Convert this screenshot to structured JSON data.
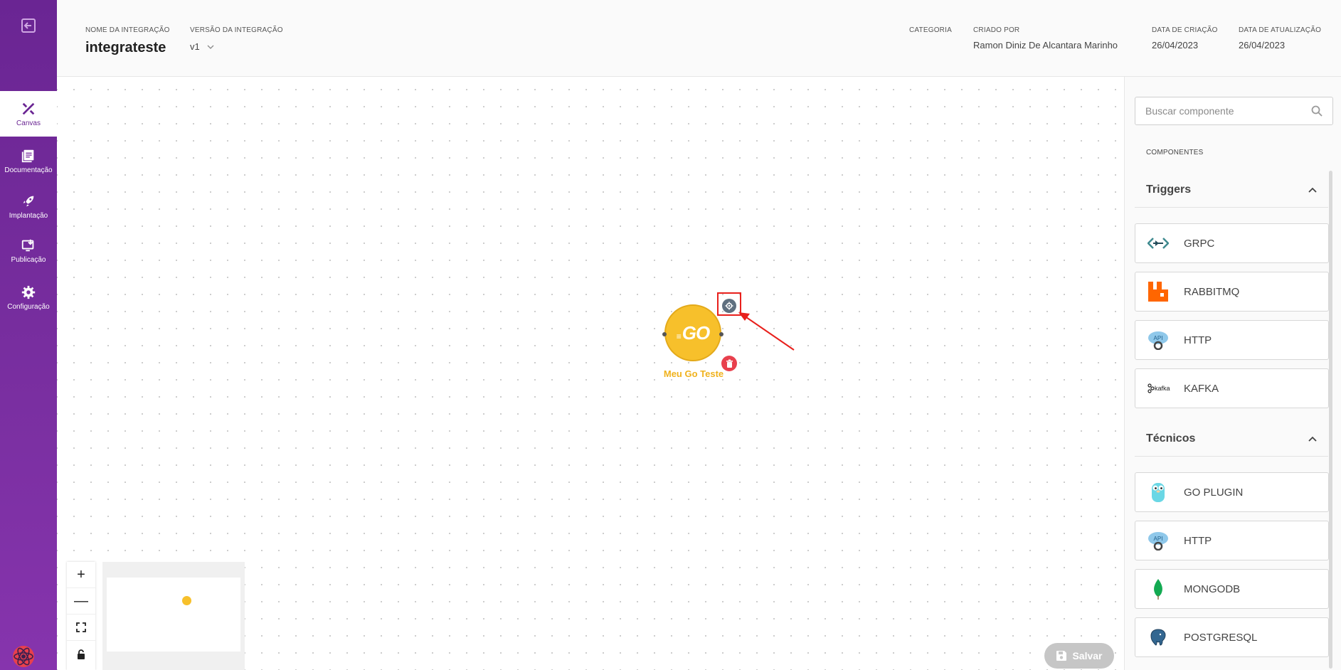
{
  "sidebar": {
    "exit_icon": "exit-icon",
    "items": [
      {
        "label": "Canvas",
        "icon": "tools-icon",
        "active": true
      },
      {
        "label": "Documentação",
        "icon": "book-icon",
        "active": false
      },
      {
        "label": "Implantação",
        "icon": "rocket-icon",
        "active": false
      },
      {
        "label": "Publicação",
        "icon": "publish-icon",
        "active": false
      },
      {
        "label": "Configuração",
        "icon": "gear-icon",
        "active": false
      }
    ]
  },
  "header": {
    "name_label": "NOME DA INTEGRAÇÃO",
    "name_value": "integrateste",
    "version_label": "VERSÃO DA INTEGRAÇÃO",
    "version_value": "v1",
    "category_label": "CATEGORIA",
    "category_value": "",
    "created_by_label": "CRIADO POR",
    "created_by_value": "Ramon Diniz De Alcantara Marinho",
    "created_date_label": "DATA DE CRIAÇÃO",
    "created_date_value": "26/04/2023",
    "updated_date_label": "DATA DE ATUALIZAÇÃO",
    "updated_date_value": "26/04/2023"
  },
  "canvas": {
    "node": {
      "logo_text": "GO",
      "label": "Meu Go Teste",
      "color": "#f7c02b"
    },
    "annotation_color": "#e8201c"
  },
  "controls": {
    "zoom_in": "+",
    "zoom_out": "—",
    "fit": "fit-view-icon",
    "lock": "lock-icon"
  },
  "save_button": {
    "label": "Salvar"
  },
  "panel": {
    "search_placeholder": "Buscar componente",
    "components_title": "COMPONENTES",
    "sections": [
      {
        "title": "Triggers",
        "items": [
          "GRPC",
          "RABBITMQ",
          "HTTP",
          "KAFKA"
        ]
      },
      {
        "title": "Técnicos",
        "items": [
          "GO PLUGIN",
          "HTTP",
          "MONGODB",
          "POSTGRESQL"
        ]
      }
    ]
  },
  "colors": {
    "sidebar": "#6a2593",
    "accent": "#6a2593",
    "go_yellow": "#f7c02b",
    "delete_red": "#e8404d"
  }
}
